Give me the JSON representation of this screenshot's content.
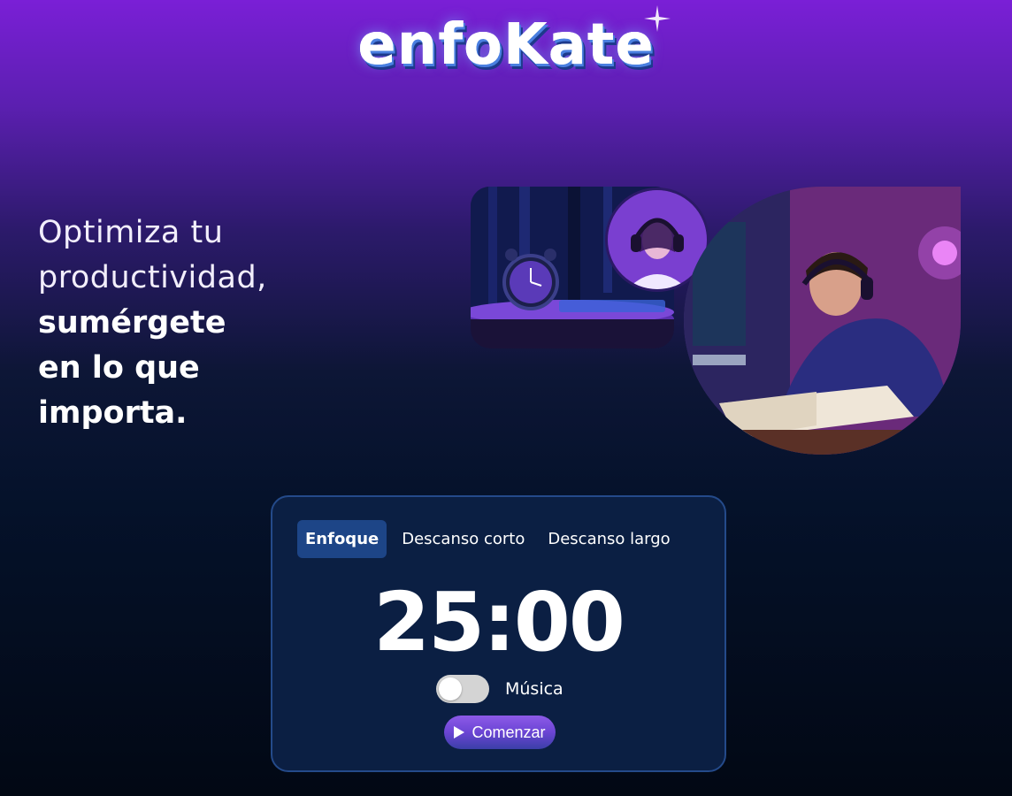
{
  "brand": {
    "logo_text": "enfoKate"
  },
  "hero": {
    "line1": "Optimiza tu",
    "line2": "productividad,",
    "line3": "sumérgete",
    "line4": "en lo que",
    "line5": "importa."
  },
  "images": {
    "clock": "alarm-clock-image",
    "woman": "woman-headphones-image",
    "man": "man-studying-image"
  },
  "timer": {
    "tabs": [
      {
        "label": "Enfoque",
        "active": true
      },
      {
        "label": "Descanso corto",
        "active": false
      },
      {
        "label": "Descanso largo",
        "active": false
      }
    ],
    "time": "25:00",
    "music_label": "Música",
    "music_on": false,
    "start_label": "Comenzar"
  },
  "colors": {
    "background_top": "#7a1fd6",
    "background_bottom": "#020814",
    "card": "#0b1f43",
    "active_tab": "#1d4587",
    "button_gradient_top": "#8d5ae8"
  }
}
